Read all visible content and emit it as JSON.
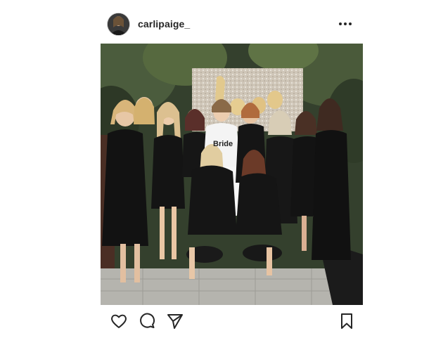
{
  "post": {
    "username": "carlipaige_",
    "avatar_icon": "profile-photo-avatar",
    "more_icon": "more-options-icon",
    "photo_description_icon": "group-photo",
    "actions": {
      "like_icon": "heart-icon",
      "comment_icon": "comment-icon",
      "share_icon": "send-icon",
      "save_icon": "bookmark-icon"
    },
    "photo_sign_text": "Bride"
  },
  "colors": {
    "text": "#262626",
    "icon": "#262626",
    "divider": "#e2e2e2",
    "background": "#ffffff"
  }
}
